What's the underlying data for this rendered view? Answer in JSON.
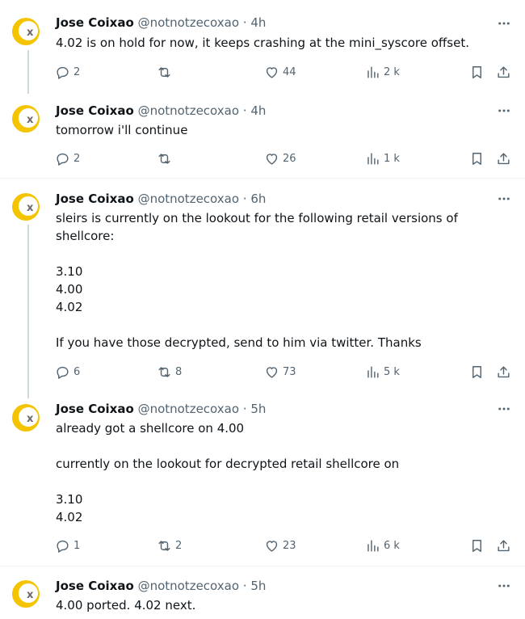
{
  "author": {
    "name": "Jose Coixao",
    "handle": "@notnotzecoxao",
    "avatar_colors": {
      "ring": "#f5c400",
      "x": "#6b6b6b"
    }
  },
  "colors": {
    "text": "#0f1419",
    "muted": "#536471",
    "thread_line": "#cfd9de",
    "divider": "#eff3f4"
  },
  "tweets": [
    {
      "time": "· 4h",
      "text": "4.02 is on hold for now, it keeps crashing at the mini_syscore offset.",
      "replies": "2",
      "retweets": "",
      "likes": "44",
      "views": "2 k"
    },
    {
      "time": "· 4h",
      "text": "tomorrow i'll continue",
      "replies": "2",
      "retweets": "",
      "likes": "26",
      "views": "1 k"
    },
    {
      "time": "· 6h",
      "text": "sleirs is currently on the lookout for the following retail versions of\nshellcore:\n\n3.10\n4.00\n4.02\n\nIf you have those decrypted, send to him via twitter. Thanks",
      "replies": "6",
      "retweets": "8",
      "likes": "73",
      "views": "5 k"
    },
    {
      "time": "· 5h",
      "text": "already got a shellcore on 4.00\n\ncurrently on the lookout for decrypted retail shellcore on\n\n3.10\n4.02",
      "replies": "1",
      "retweets": "2",
      "likes": "23",
      "views": "6 k"
    },
    {
      "time": "· 5h",
      "text": "4.00 ported. 4.02 next.",
      "replies": "",
      "retweets": "",
      "likes": "",
      "views": ""
    }
  ]
}
